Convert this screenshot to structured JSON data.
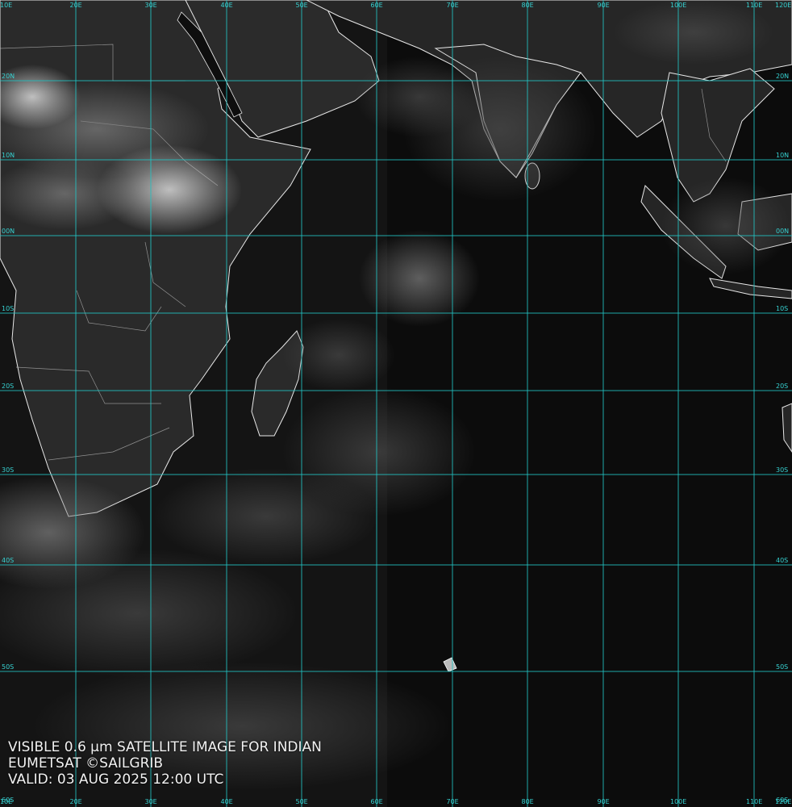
{
  "caption": {
    "line1": "VISIBLE 0.6 µm SATELLITE IMAGE FOR INDIAN",
    "line2": "EUMETSAT ©SAILGRIB",
    "line3": "VALID:  03 AUG 2025 12:00 UTC"
  },
  "grid": {
    "color": "#22c4c4",
    "longitudes": [
      "10E",
      "20E",
      "30E",
      "40E",
      "50E",
      "60E",
      "70E",
      "80E",
      "90E",
      "100E",
      "110E",
      "120E"
    ],
    "latitudes": [
      "20N",
      "10N",
      "00N",
      "10S",
      "20S",
      "30S",
      "40S",
      "50S",
      "60S"
    ]
  },
  "colors": {
    "land_outline": "#e8e8e8",
    "ocean": "#0b0b0b",
    "cloud": "#9a9a9a"
  }
}
